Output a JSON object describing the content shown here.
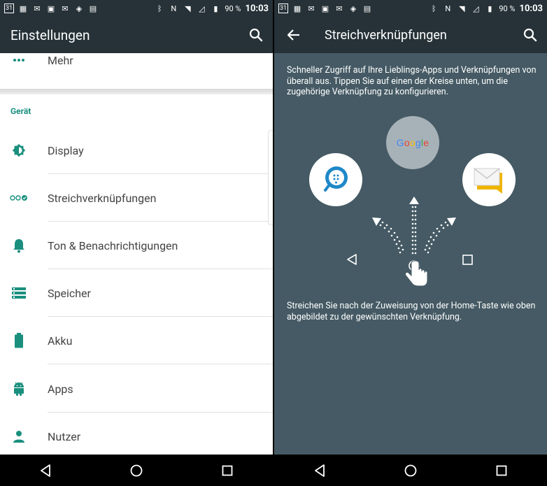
{
  "status_bar": {
    "calendar_day": "31",
    "battery_percent": "90 %",
    "time": "10:03"
  },
  "left_screen": {
    "title": "Einstellungen",
    "more_item": "Mehr",
    "section_header": "Gerät",
    "items": [
      {
        "label": "Display",
        "icon": "brightness-icon"
      },
      {
        "label": "Streichverknüpfungen",
        "icon": "swipe-shortcuts-icon"
      },
      {
        "label": "Ton & Benachrichtigungen",
        "icon": "bell-icon"
      },
      {
        "label": "Speicher",
        "icon": "storage-icon"
      },
      {
        "label": "Akku",
        "icon": "battery-icon"
      },
      {
        "label": "Apps",
        "icon": "android-icon"
      },
      {
        "label": "Nutzer",
        "icon": "person-icon"
      }
    ]
  },
  "right_screen": {
    "title": "Streichverknüpfungen",
    "description_top": "Schneller Zugriff auf Ihre Lieblings-Apps und Verknüpfungen von überall aus. Tippen Sie auf einen der Kreise unten, um die zugehörige Verknüpfung zu konfigurieren.",
    "google_label": "Google",
    "description_bottom": "Streichen Sie nach der Zuweisung von der Home-Taste wie oben abgebildet zu der gewünschten Verknüpfung."
  },
  "colors": {
    "appbar": "#263238",
    "accent": "#1a8f7e",
    "right_background": "#455A64"
  }
}
